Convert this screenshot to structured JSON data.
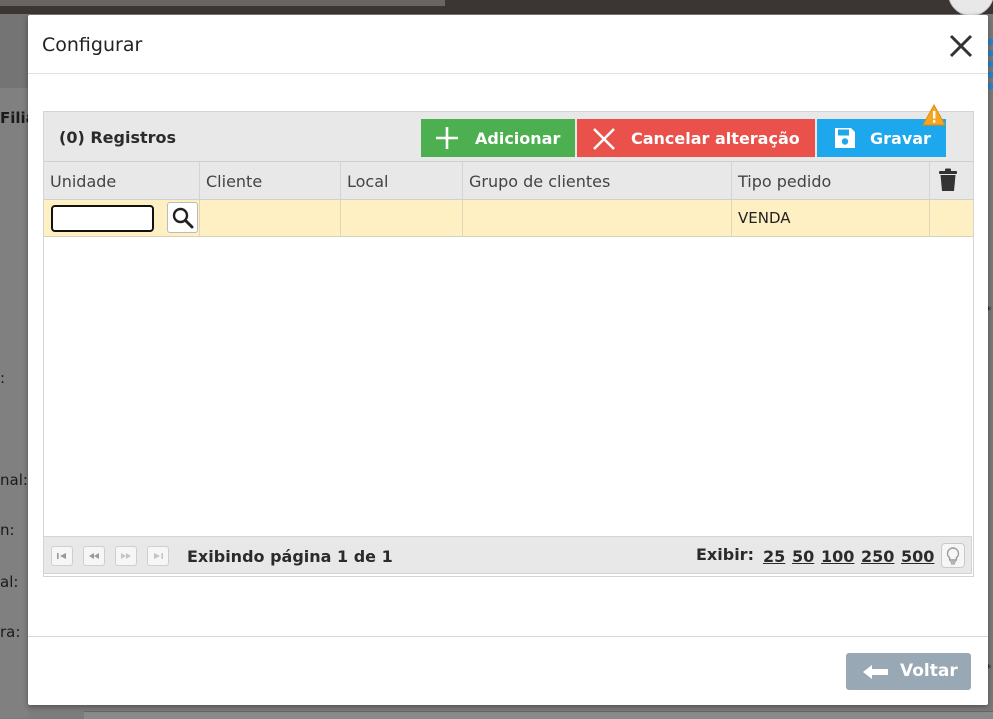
{
  "background": {
    "labels": [
      "Filia",
      ":",
      "nal:",
      "n:",
      "al:",
      "ra:"
    ]
  },
  "modal": {
    "title": "Configurar",
    "toolbar": {
      "records_label": "(0) Registros",
      "add_label": "Adicionar",
      "cancel_label": "Cancelar alteração",
      "save_label": "Gravar"
    },
    "columns": [
      "Unidade",
      "Cliente",
      "Local",
      "Grupo de clientes",
      "Tipo pedido"
    ],
    "row": {
      "unidade": "",
      "cliente": "",
      "local": "",
      "grupo_de_clientes": "",
      "tipo_pedido": "VENDA"
    },
    "pager": {
      "page_info": "Exibindo página 1 de 1",
      "show_label": "Exibir:",
      "page_sizes": [
        "25",
        "50",
        "100",
        "250",
        "500"
      ]
    },
    "footer": {
      "back_label": "Voltar"
    }
  },
  "colors": {
    "add": "#4caf50",
    "cancel": "#e9514a",
    "save": "#1da7ec",
    "back": "#98a9b5",
    "row_highlight": "#fff0c4",
    "warning": "#f5a623"
  },
  "icons": {
    "close": "close-icon",
    "add": "plus-icon",
    "cancel": "x-icon",
    "save": "floppy-disk-icon",
    "warning": "warning-icon",
    "lookup": "search-icon",
    "delete": "trash-icon",
    "back": "arrow-left-icon",
    "bulb": "lightbulb-icon"
  }
}
